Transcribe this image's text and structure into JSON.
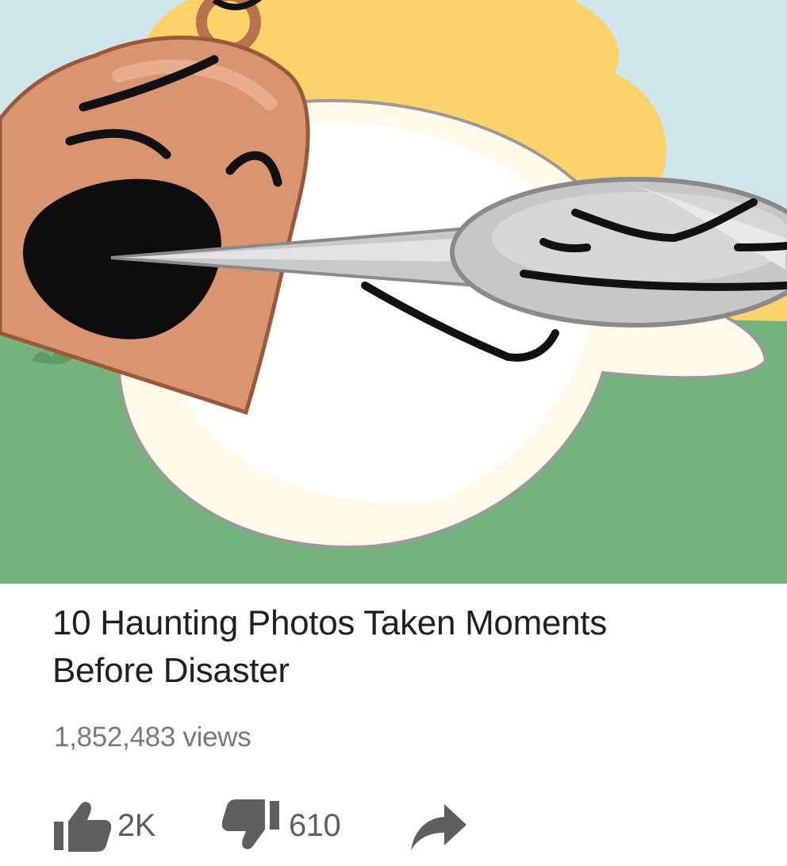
{
  "video": {
    "title": "10 Haunting Photos Taken Moments Before Disaster",
    "views": "1,852,483 views",
    "likes": "2K",
    "dislikes": "610"
  },
  "icons": {
    "like": "thumbs-up-icon",
    "dislike": "thumbs-down-icon",
    "share": "share-arrow-icon"
  },
  "colors": {
    "sky": "#cfe7ea",
    "sun": "#fbd36a",
    "grass": "#74b47c",
    "bell": "#d99470",
    "icon_gray": "#5f5f5f",
    "title_text": "#202020",
    "views_text": "#7a7a7a"
  }
}
